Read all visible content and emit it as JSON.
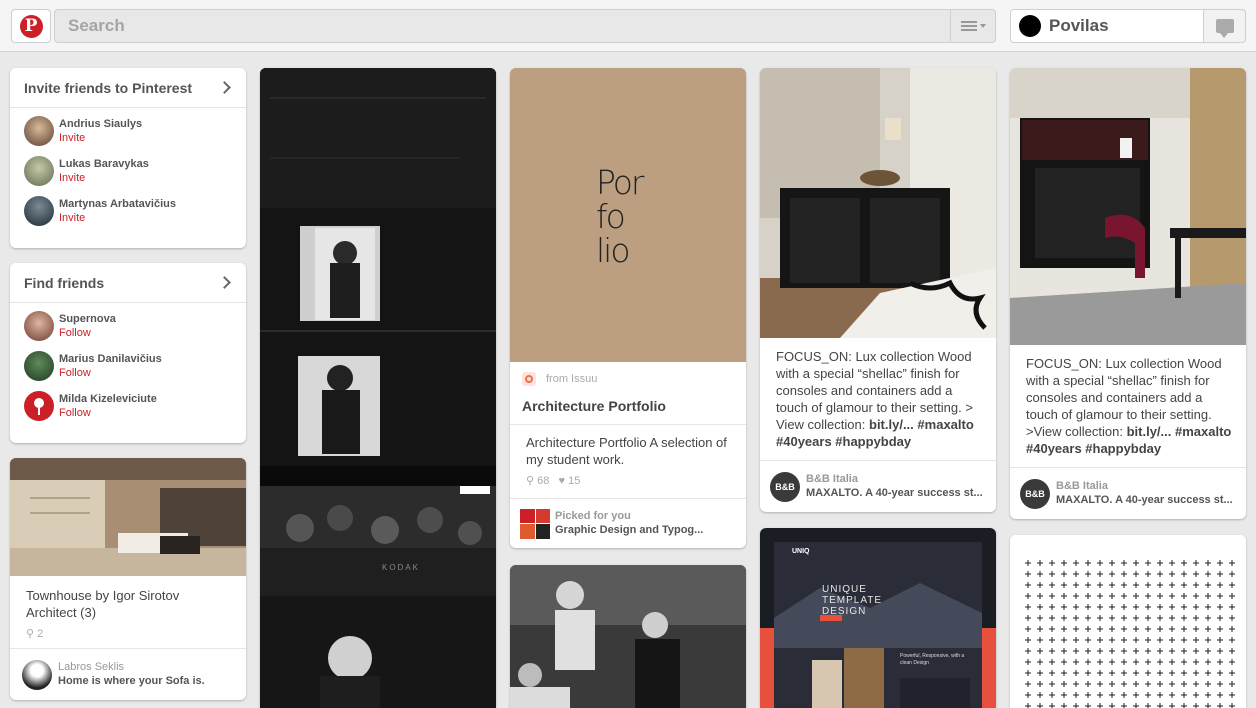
{
  "header": {
    "search_placeholder": "Search",
    "user_name": "Povilas",
    "brand_color": "#cb2027"
  },
  "invite_card": {
    "title": "Invite friends to Pinterest",
    "friends": [
      {
        "name": "Andrius Siaulys",
        "action": "Invite"
      },
      {
        "name": "Lukas Baravykas",
        "action": "Invite"
      },
      {
        "name": "Martynas Arbatavičius",
        "action": "Invite"
      }
    ]
  },
  "find_card": {
    "title": "Find friends",
    "friends": [
      {
        "name": "Supernova",
        "action": "Follow"
      },
      {
        "name": "Marius Danilavičius",
        "action": "Follow"
      },
      {
        "name": "Milda Kizeleviciute",
        "action": "Follow"
      }
    ]
  },
  "pins": {
    "townhouse": {
      "description": "Townhouse by Igor Sirotov Architect (3)",
      "repins": "2",
      "pinner": "Labros Seklis",
      "board": "Home is where your Sofa is."
    },
    "portfolio": {
      "source": "from Issuu",
      "title": "Architecture Portfolio",
      "description": "Architecture Portfolio A selection of my student work.",
      "repins": "68",
      "likes": "15",
      "picked_label": "Picked for you",
      "board": "Graphic Design and Typog..."
    },
    "bb1": {
      "description": "FOCUS_ON: Lux collection Wood with a special “shellac” finish for consoles and containers add a touch of glamour to their setting. > View collection:",
      "link": "bit.ly/...",
      "tags": "#maxalto #40years #happybday",
      "pinner": "B&B Italia",
      "board": "MAXALTO. A 40-year success st..."
    },
    "bb2": {
      "description": "FOCUS_ON: Lux collection Wood with a special “shellac” finish for consoles and containers add a touch of glamour to their setting. >View collection:",
      "link": "bit.ly/...",
      "tags": "#maxalto #40years #happybday",
      "pinner": "B&B Italia",
      "board": "MAXALTO. A 40-year success st..."
    },
    "template": {
      "brand": "UNIQ",
      "heading": "UNIQUE TEMPLATE DESIGN",
      "sub": "Powerful, Responsive, with a clean Design"
    },
    "film": {
      "label": "KODAK"
    },
    "portfolio_cover": {
      "text": "Por fo lio"
    }
  }
}
